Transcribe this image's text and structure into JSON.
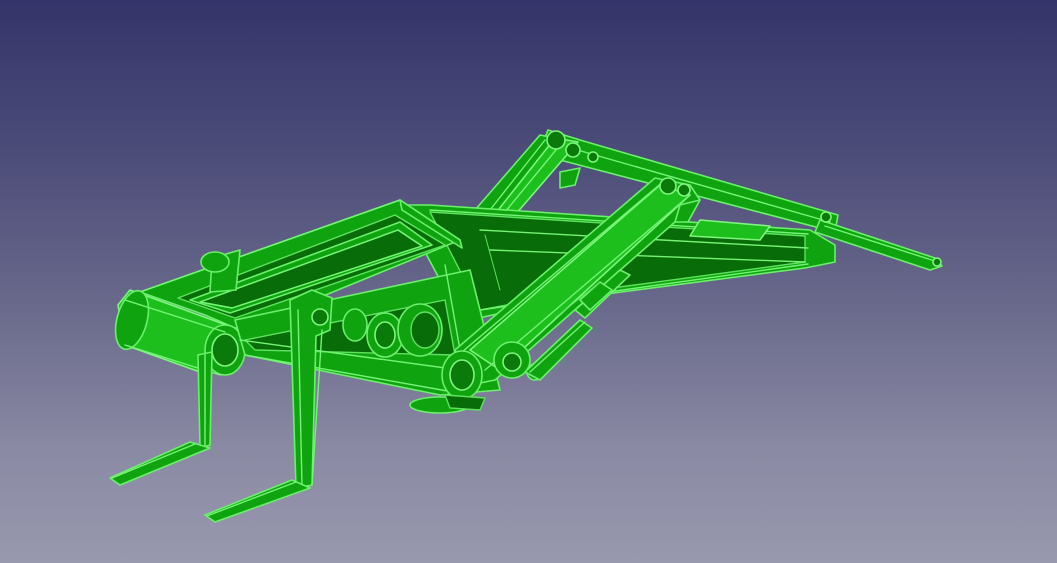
{
  "viewer": {
    "background_top": "#34346a",
    "background_bottom": "#9898ae",
    "model_color": "#0fa30f",
    "edge_color": "#6cf06c"
  }
}
